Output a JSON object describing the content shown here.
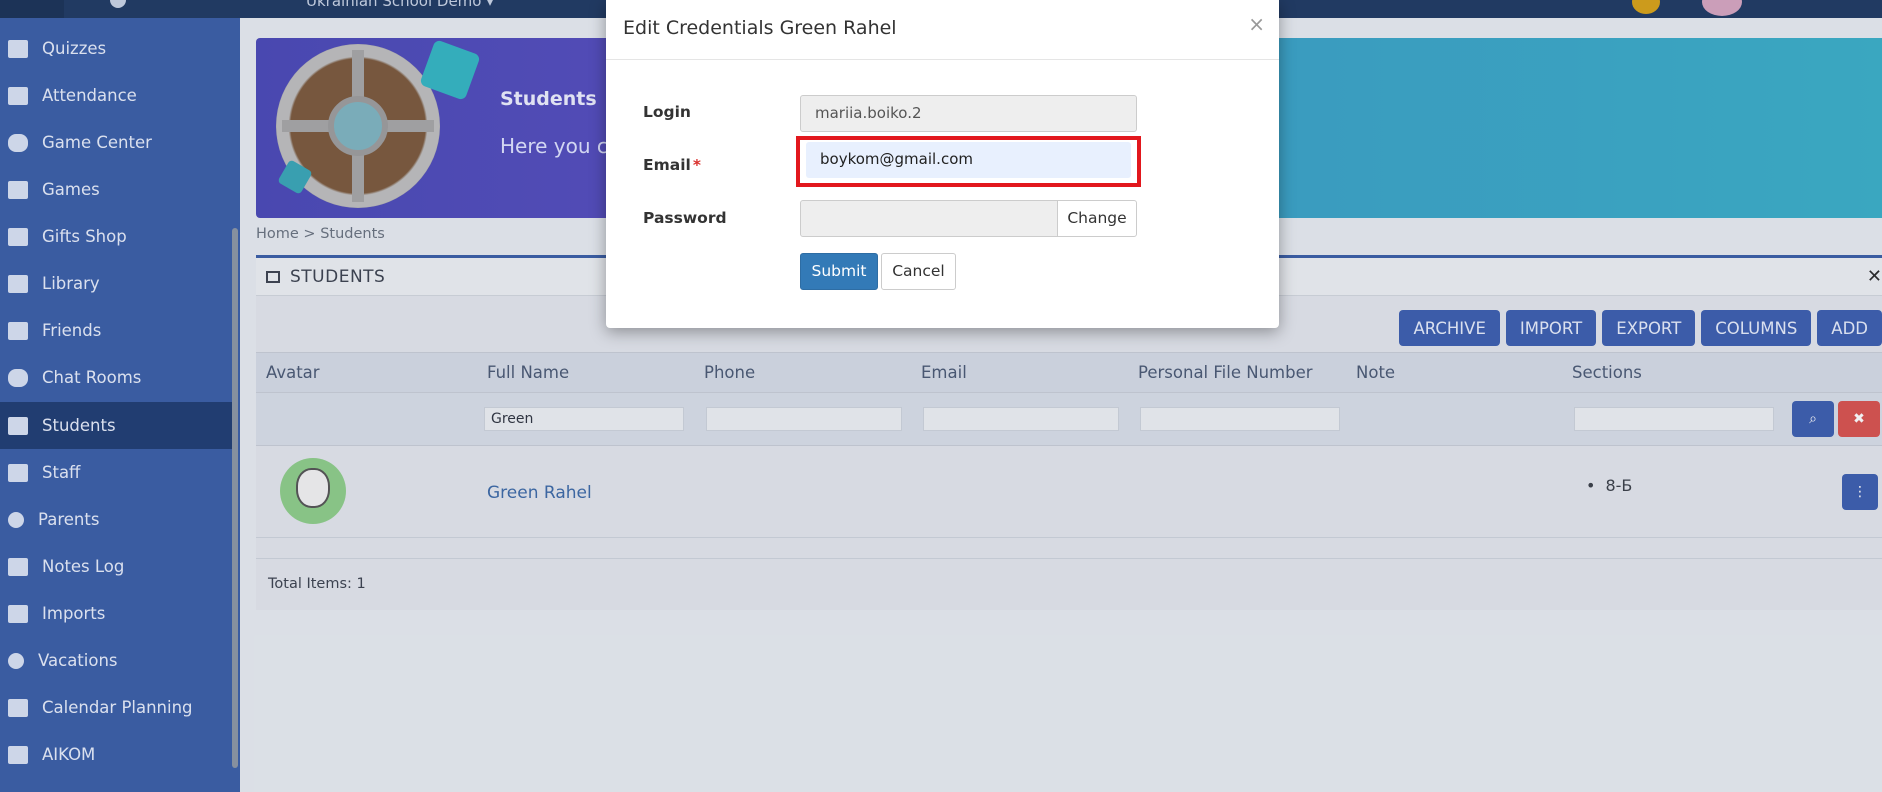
{
  "topbar": {
    "school_name": "Ukrainian School Demo ▾"
  },
  "sidebar": {
    "items": [
      {
        "label": "Quizzes",
        "icon": "list-icon"
      },
      {
        "label": "Attendance",
        "icon": "attendance-icon"
      },
      {
        "label": "Game Center",
        "icon": "gamepad-icon"
      },
      {
        "label": "Games",
        "icon": "rocket-icon"
      },
      {
        "label": "Gifts Shop",
        "icon": "gift-icon"
      },
      {
        "label": "Library",
        "icon": "book-icon"
      },
      {
        "label": "Friends",
        "icon": "users-icon"
      },
      {
        "label": "Chat Rooms",
        "icon": "chat-icon"
      },
      {
        "label": "Students",
        "icon": "graduation-cap-icon",
        "active": true
      },
      {
        "label": "Staff",
        "icon": "staff-icon"
      },
      {
        "label": "Parents",
        "icon": "parent-icon"
      },
      {
        "label": "Notes Log",
        "icon": "notes-icon"
      },
      {
        "label": "Imports",
        "icon": "upload-icon"
      },
      {
        "label": "Vacations",
        "icon": "circle-icon"
      },
      {
        "label": "Calendar Planning",
        "icon": "calendar-icon"
      },
      {
        "label": "AIKOM",
        "icon": "shuffle-icon"
      }
    ]
  },
  "banner": {
    "title": "Students",
    "subtitle": "Here you ca"
  },
  "breadcrumb": {
    "home": "Home",
    "separator": " > ",
    "current": "Students"
  },
  "panel": {
    "title": "STUDENTS",
    "toolbar": [
      "ARCHIVE",
      "IMPORT",
      "EXPORT",
      "COLUMNS",
      "ADD"
    ],
    "columns": [
      "Avatar",
      "Full Name",
      "Phone",
      "Email",
      "Personal File Number",
      "Note",
      "Sections"
    ],
    "filters": {
      "full_name": "Green"
    },
    "rows": [
      {
        "full_name": "Green Rahel",
        "sections": [
          "8-Б"
        ]
      }
    ],
    "total": "Total Items: 1"
  },
  "modal": {
    "title": "Edit Credentials Green Rahel",
    "login_label": "Login",
    "login_value": "mariia.boiko.2",
    "email_label": "Email",
    "email_required": "*",
    "email_value": "boykom@gmail.com",
    "password_label": "Password",
    "change_label": "Change",
    "submit_label": "Submit",
    "cancel_label": "Cancel",
    "close_symbol": "×"
  },
  "colors": {
    "sidebar": "#3a5fa8",
    "accent": "#337ab7",
    "highlight": "#e2171d"
  }
}
